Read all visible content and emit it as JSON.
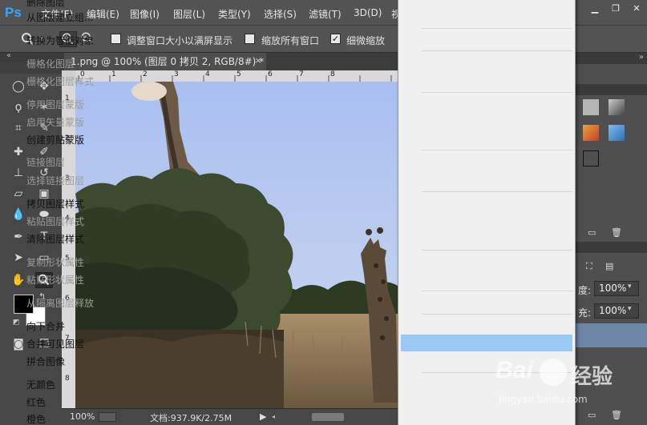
{
  "app": {
    "logo": "Ps",
    "menu": [
      "文件(F)",
      "编辑(E)",
      "图像(I)",
      "图层(L)",
      "类型(Y)",
      "选择(S)",
      "滤镜(T)",
      "3D(D)",
      "视"
    ],
    "window_buttons": [
      "minimize-icon",
      "restore-icon",
      "close-icon"
    ]
  },
  "options_bar": {
    "tool_icon": "zoom-icon",
    "zoom_in_icon": "zoom-in-icon",
    "zoom_out_icon": "zoom-out-icon",
    "resize_windows_label": "调整窗口大小以满屏显示",
    "resize_windows_checked": false,
    "zoom_all_label": "缩放所有窗口",
    "zoom_all_checked": false,
    "scrubby_label": "细微缩放",
    "scrubby_checked": true
  },
  "document": {
    "tab_title": "1.png @ 100% (图层 0 拷贝 2, RGB/8#) *",
    "close_glyph": "×"
  },
  "ruler": {
    "h_ticks": [
      "0",
      "1",
      "2",
      "3",
      "4",
      "5",
      "6",
      "7",
      "8"
    ],
    "v_ticks": [
      "1",
      "2",
      "3",
      "4",
      "5",
      "6",
      "7",
      "8"
    ]
  },
  "status": {
    "zoom": "100%",
    "doc": "文档:937.9K/2.75M"
  },
  "context_menu": {
    "items": [
      {
        "label": "删除图层",
        "disabled": false,
        "partial": true
      },
      {
        "label": "从图层建立组...",
        "disabled": false
      },
      {
        "label": "转换为智能对象",
        "disabled": false
      },
      {
        "label": "栅格化图层",
        "disabled": true
      },
      {
        "label": "栅格化图层样式",
        "disabled": true
      },
      {
        "label": "停用图层蒙版",
        "disabled": true
      },
      {
        "label": "启用矢量蒙版",
        "disabled": true
      },
      {
        "label": "创建剪贴蒙版",
        "disabled": false
      },
      {
        "label": "链接图层",
        "disabled": true
      },
      {
        "label": "选择链接图层",
        "disabled": true
      },
      {
        "label": "拷贝图层样式",
        "disabled": false
      },
      {
        "label": "粘贴图层样式",
        "disabled": true
      },
      {
        "label": "清除图层样式",
        "disabled": false
      },
      {
        "label": "复制形状属性",
        "disabled": true
      },
      {
        "label": "粘贴形状属性",
        "disabled": true
      },
      {
        "label": "从隔离图层释放",
        "disabled": true
      },
      {
        "label": "向下合并",
        "disabled": false
      },
      {
        "label": "合并可见图层",
        "disabled": false,
        "highlighted": true
      },
      {
        "label": "拼合图像",
        "disabled": false
      },
      {
        "label": "无颜色",
        "disabled": false
      },
      {
        "label": "红色",
        "disabled": false
      },
      {
        "label": "橙色",
        "disabled": false
      }
    ]
  },
  "layers_panel": {
    "opacity_label": "度:",
    "opacity_value": "100%",
    "fill_label": "充:",
    "fill_value": "100%"
  },
  "watermark": {
    "brand": "Bai",
    "brand2": "经验",
    "url": "jingyan.baidu.com"
  },
  "colors": {
    "foreground": "#000000",
    "background": "#ffffff",
    "menu_highlight": "#9ac9f5",
    "ps_blue": "#31a8ff"
  }
}
